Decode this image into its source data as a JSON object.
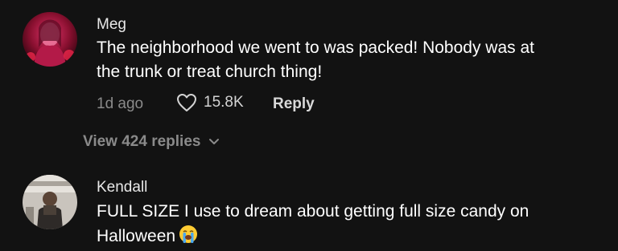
{
  "comments": [
    {
      "username": "Meg",
      "text_line1": "The neighborhood we went to was packed! Nobody was at",
      "text_line2": "the trunk or treat church thing!",
      "time": "1d ago",
      "likes": "15.8K",
      "reply_label": "Reply",
      "view_replies": "View 424 replies",
      "avatar_icon": "profile-photo-red-tint"
    },
    {
      "username": "Kendall",
      "text_line1": "FULL SIZE I use to dream about getting full size candy on",
      "text_line2": "Halloween",
      "emoji": "loudly-crying-face",
      "avatar_icon": "profile-photo"
    }
  ],
  "colors": {
    "background": "#121212",
    "text_primary": "#ffffff",
    "text_secondary": "#8a8a8a"
  }
}
